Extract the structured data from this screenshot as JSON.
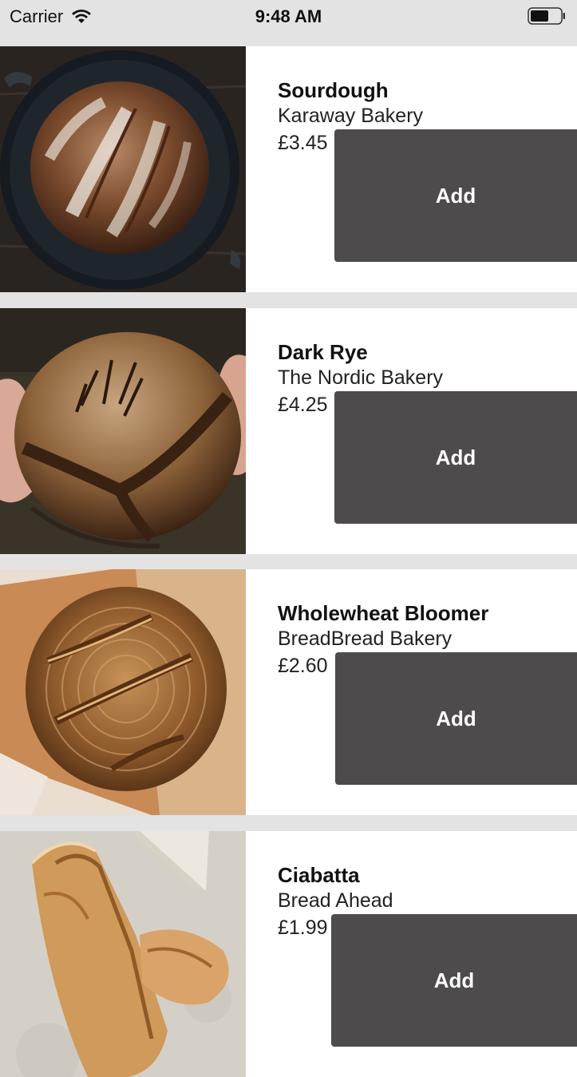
{
  "status_bar": {
    "carrier": "Carrier",
    "time": "9:48 AM"
  },
  "products": [
    {
      "name": "Sourdough",
      "bakery": "Karaway Bakery",
      "price": "£3.45",
      "button_label": "Add"
    },
    {
      "name": "Dark Rye",
      "bakery": "The Nordic Bakery",
      "price": "£4.25",
      "button_label": "Add"
    },
    {
      "name": "Wholewheat Bloomer",
      "bakery": "BreadBread Bakery",
      "price": "£2.60",
      "button_label": "Add"
    },
    {
      "name": "Ciabatta",
      "bakery": "Bread Ahead",
      "price": "£1.99",
      "button_label": "Add"
    }
  ]
}
